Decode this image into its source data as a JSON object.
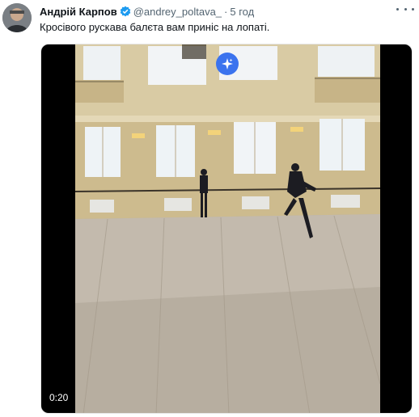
{
  "tweet": {
    "author_name": "Андрій Карпов",
    "handle": "@andrey_poltava_",
    "separator": "·",
    "time": "5 год",
    "text": "Кросівого рускава балєта вам приніс на лопаті.",
    "video_duration": "0:20",
    "icons": {
      "verified": "verified-badge-icon",
      "more": "more-options-icon",
      "media_overlay": "sparkle-icon"
    }
  },
  "colors": {
    "verified_blue": "#1d9bf0",
    "secondary_text": "#536471",
    "primary_text": "#0f1419",
    "overlay_badge": "#3b73ee"
  }
}
